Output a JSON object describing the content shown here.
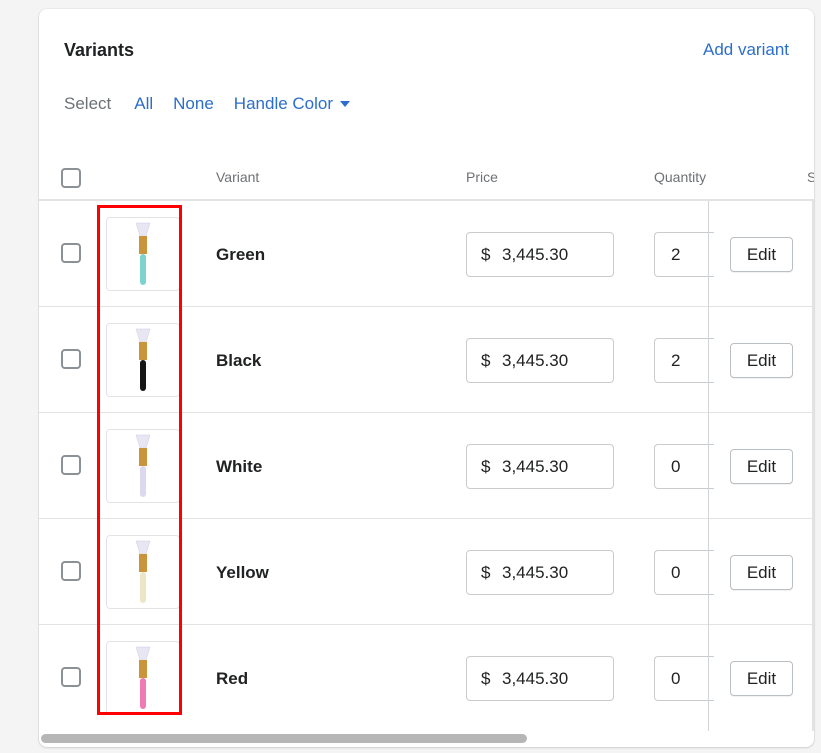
{
  "card": {
    "title": "Variants",
    "add_variant_label": "Add variant"
  },
  "select_bar": {
    "label": "Select",
    "all_label": "All",
    "none_label": "None",
    "handle_color_label": "Handle Color"
  },
  "table": {
    "headers": {
      "variant": "Variant",
      "price": "Price",
      "quantity": "Quantity",
      "next": "S"
    },
    "rows": [
      {
        "name": "Green",
        "currency": "$",
        "price": "3,445.30",
        "quantity": "2",
        "edit_label": "Edit",
        "handle_color": "#7fd3cf"
      },
      {
        "name": "Black",
        "currency": "$",
        "price": "3,445.30",
        "quantity": "2",
        "edit_label": "Edit",
        "handle_color": "#151515"
      },
      {
        "name": "White",
        "currency": "$",
        "price": "3,445.30",
        "quantity": "0",
        "edit_label": "Edit",
        "handle_color": "#dcd9ee"
      },
      {
        "name": "Yellow",
        "currency": "$",
        "price": "3,445.30",
        "quantity": "0",
        "edit_label": "Edit",
        "handle_color": "#ece6c7"
      },
      {
        "name": "Red",
        "currency": "$",
        "price": "3,445.30",
        "quantity": "0",
        "edit_label": "Edit",
        "handle_color": "#f07ab4"
      }
    ]
  },
  "colors": {
    "link": "#2c6ecb",
    "highlight": "#ff0000",
    "ferrule": "#c9943a",
    "bristle": "#e9e6f3"
  }
}
